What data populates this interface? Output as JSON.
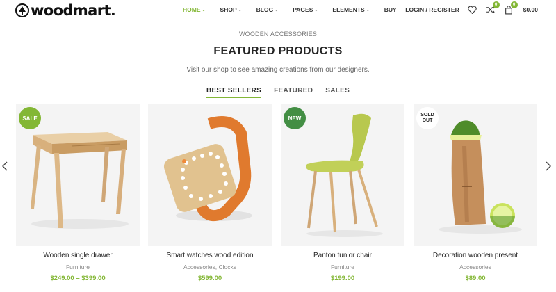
{
  "header": {
    "logo_text": "woodmart.",
    "nav": [
      {
        "label": "HOME",
        "active": true,
        "has_dropdown": true
      },
      {
        "label": "SHOP",
        "active": false,
        "has_dropdown": true
      },
      {
        "label": "BLOG",
        "active": false,
        "has_dropdown": true
      },
      {
        "label": "PAGES",
        "active": false,
        "has_dropdown": true
      },
      {
        "label": "ELEMENTS",
        "active": false,
        "has_dropdown": true
      },
      {
        "label": "BUY",
        "active": false,
        "has_dropdown": false
      }
    ],
    "login_label": "LOGIN / REGISTER",
    "wishlist_icon": "heart-icon",
    "compare_icon": "shuffle-icon",
    "compare_count": "0",
    "cart_icon": "shopping-bag-icon",
    "cart_count": "0",
    "cart_total": "$0.00"
  },
  "section": {
    "eyebrow": "WOODEN ACCESSORIES",
    "title": "FEATURED PRODUCTS",
    "subtitle": "Visit our shop to see amazing creations from our designers.",
    "tabs": [
      {
        "label": "BEST SELLERS",
        "active": true
      },
      {
        "label": "FEATURED",
        "active": false
      },
      {
        "label": "SALES",
        "active": false
      }
    ]
  },
  "products": [
    {
      "title": "Wooden single drawer",
      "category": "Furniture",
      "price": "$249.00 – $399.00",
      "label": "SALE"
    },
    {
      "title": "Smart watches wood edition",
      "category": "Accessories, Clocks",
      "price": "$599.00",
      "label": ""
    },
    {
      "title": "Panton tunior chair",
      "category": "Furniture",
      "price": "$199.00",
      "label": "NEW"
    },
    {
      "title": "Decoration wooden present",
      "category": "Accessories",
      "price": "$89.00",
      "label": "SOLD OUT"
    }
  ],
  "colors": {
    "accent": "#83b735",
    "new_badge": "#438e44",
    "card_bg": "#f4f4f4"
  }
}
